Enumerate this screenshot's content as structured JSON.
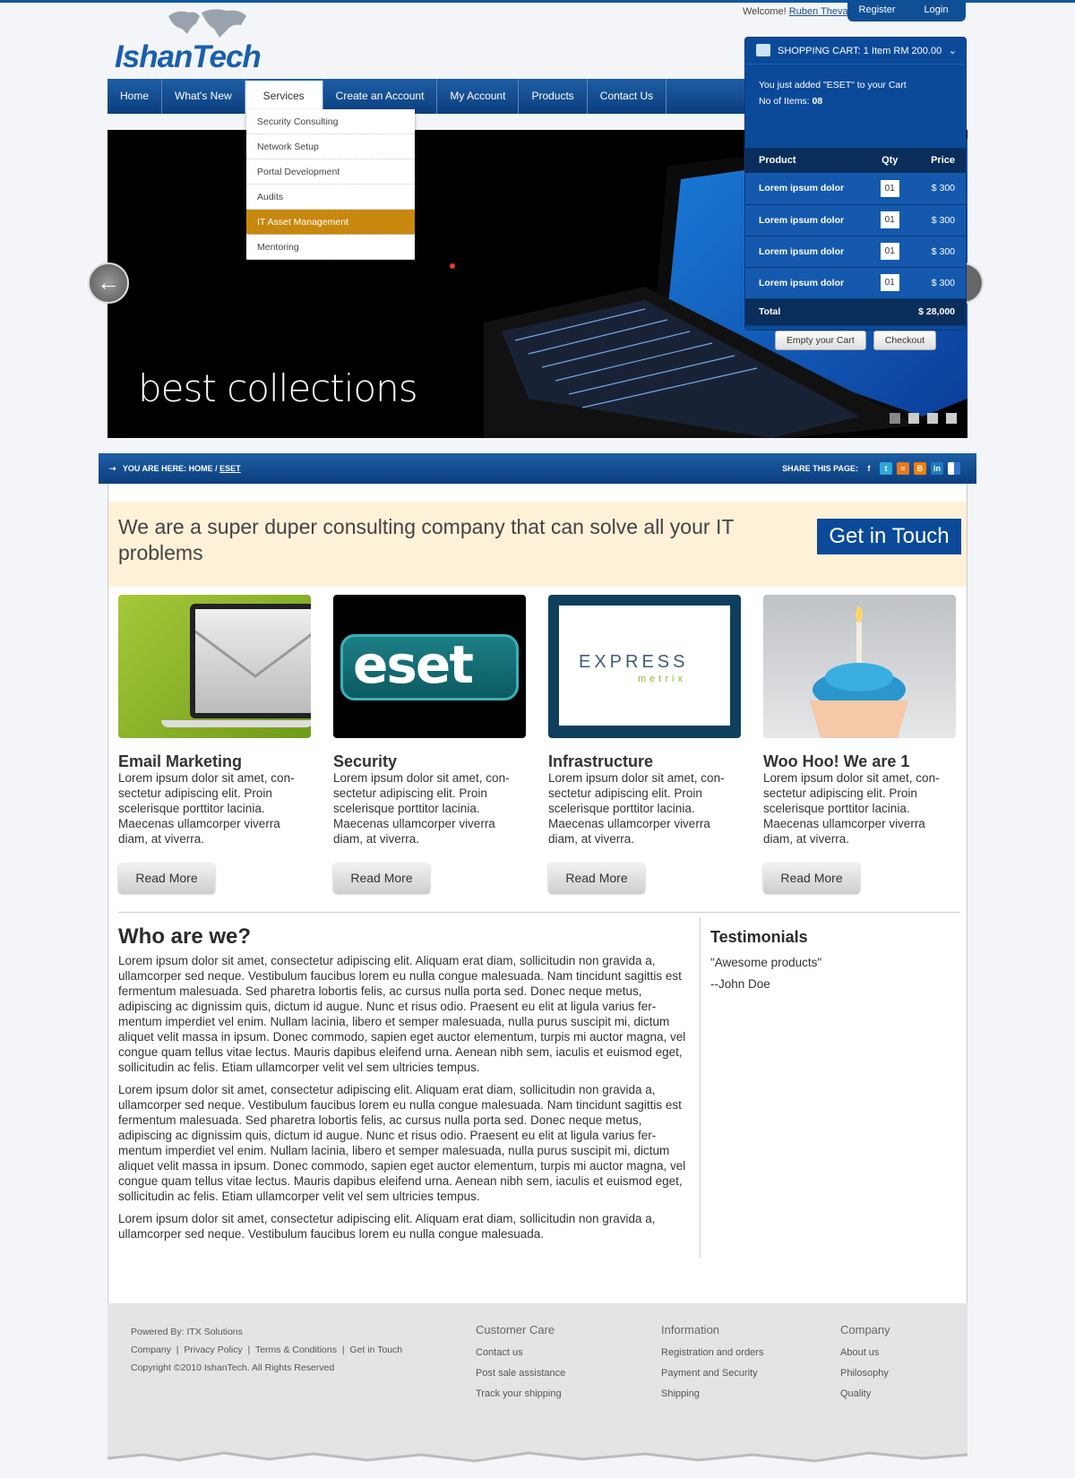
{
  "brand": {
    "name": "IshanTech"
  },
  "user": {
    "welcome": "Welcome!",
    "name": "Ruben Theva"
  },
  "auth": {
    "register": "Register",
    "login": "Login"
  },
  "nav": [
    "Home",
    "What's New",
    "Services",
    "Create an Account",
    "My Account",
    "Products",
    "Contact Us"
  ],
  "services_menu": [
    "Security Consulting",
    "Network Setup",
    "Portal Development",
    "Audits",
    "IT Asset Management",
    "Mentoring"
  ],
  "hero": {
    "caption": "best collections",
    "slides": 4,
    "active_slide": 1
  },
  "cart": {
    "title": "SHOPPING CART: 1 Item  RM 200.00",
    "added_msg": "You just added \"ESET\" to your Cart",
    "items_label": "No of Items:",
    "items_count": "08",
    "headers": {
      "product": "Product",
      "qty": "Qty",
      "price": "Price"
    },
    "rows": [
      {
        "product": "Lorem ipsum dolor",
        "qty": "01",
        "price": "$ 300"
      },
      {
        "product": "Lorem ipsum dolor",
        "qty": "01",
        "price": "$ 300"
      },
      {
        "product": "Lorem ipsum dolor",
        "qty": "01",
        "price": "$ 300"
      },
      {
        "product": "Lorem ipsum dolor",
        "qty": "01",
        "price": "$ 300"
      }
    ],
    "total_label": "Total",
    "total_value": "$ 28,000",
    "empty_btn": "Empty your Cart",
    "checkout_btn": "Checkout"
  },
  "breadcrumb": {
    "prefix": "YOU ARE HERE:",
    "home": "HOME",
    "sep": "/",
    "current": "ESET",
    "share": "SHARE THIS PAGE:"
  },
  "promo": {
    "text": "We are a super duper consulting company that can solve all your IT problems",
    "button": "Get in Touch"
  },
  "features": [
    {
      "title": "Email Marketing",
      "body": "Lorem ipsum dolor sit amet, con-sectetur adipiscing elit. Proin scelerisque porttitor lacinia. Maecenas ullamcorper viverra diam, at viverra.",
      "button": "Read More"
    },
    {
      "title": "Security",
      "body": "Lorem ipsum dolor sit amet, con-sectetur adipiscing elit. Proin scelerisque porttitor lacinia. Maecenas ullamcorper viverra diam, at viverra.",
      "button": "Read More",
      "logo": "eset"
    },
    {
      "title": "Infrastructure",
      "body": "Lorem ipsum dolor sit amet, con-sectetur adipiscing elit. Proin scelerisque porttitor lacinia. Maecenas ullamcorper viverra diam, at viverra.",
      "button": "Read More",
      "logo1": "EXPRESS",
      "logo2": "metrix"
    },
    {
      "title": "Woo Hoo! We are 1",
      "body": "Lorem ipsum dolor sit amet, con-sectetur adipiscing elit. Proin scelerisque porttitor lacinia. Maecenas ullamcorper viverra diam, at viverra.",
      "button": "Read More"
    }
  ],
  "who": {
    "title": "Who are we?",
    "p1": "Lorem ipsum dolor sit amet, consectetur adipiscing elit. Aliquam erat diam, sollicitudin non gravida a, ullamcorper sed neque. Vestibulum faucibus lorem eu nulla congue malesuada. Nam tincidunt sagittis est fermentum malesuada. Sed pharetra lobortis felis, ac cursus nulla porta sed. Donec neque metus, adipiscing ac dignissim quis, dictum id augue. Nunc et risus odio. Praesent eu elit at ligula varius fer-mentum imperdiet vel enim. Nullam lacinia, libero et semper malesuada, nulla purus suscipit mi, dictum aliquet velit massa in ipsum. Donec commodo, sapien eget auctor elementum, turpis mi auctor magna, vel congue quam tellus vitae lectus. Mauris dapibus eleifend urna. Aenean nibh sem, iaculis et euismod eget, sollicitudin ac felis. Etiam ullamcorper velit vel sem ultricies tempus.",
    "p2": "Lorem ipsum dolor sit amet, consectetur adipiscing elit. Aliquam erat diam, sollicitudin non gravida a, ullamcorper sed neque. Vestibulum faucibus lorem eu nulla congue malesuada. Nam tincidunt sagittis est fermentum malesuada. Sed pharetra lobortis felis, ac cursus nulla porta sed. Donec neque metus, adipiscing ac dignissim quis, dictum id augue. Nunc et risus odio. Praesent eu elit at ligula varius fer-mentum imperdiet vel enim. Nullam lacinia, libero et semper malesuada, nulla purus suscipit mi, dictum aliquet velit massa in ipsum. Donec commodo, sapien eget auctor elementum, turpis mi auctor magna, vel congue quam tellus vitae lectus. Mauris dapibus eleifend urna. Aenean nibh sem, iaculis et euismod eget, sollicitudin ac felis. Etiam ullamcorper velit vel sem ultricies tempus.",
    "p3": "Lorem ipsum dolor sit amet, consectetur adipiscing elit. Aliquam erat diam, sollicitudin non gravida a, ullamcorper sed neque. Vestibulum faucibus lorem eu nulla congue malesuada."
  },
  "testimonials": {
    "title": "Testimonials",
    "quote": "\"Awesome products\"",
    "author": "--John Doe"
  },
  "footer": {
    "powered": "Powered By: ITX Solutions",
    "links": [
      "Company",
      "Privacy Policy",
      "Terms & Conditions",
      "Get in Touch"
    ],
    "copyright": "Copyright ©2010 IshanTech. All Rights Reserved",
    "cols": [
      {
        "title": "Customer Care",
        "links": [
          "Contact us",
          "Post sale assistance",
          "Track your shipping"
        ]
      },
      {
        "title": "Information",
        "links": [
          "Registration and orders",
          "Payment and Security",
          "Shipping"
        ]
      },
      {
        "title": "Company",
        "links": [
          "About us",
          "Philosophy",
          "Quality"
        ]
      }
    ]
  },
  "colors": {
    "brand_blue": "#0b4a99",
    "dropdown_highlight": "#c8880f",
    "promo_bg": "#fdf1d8"
  }
}
